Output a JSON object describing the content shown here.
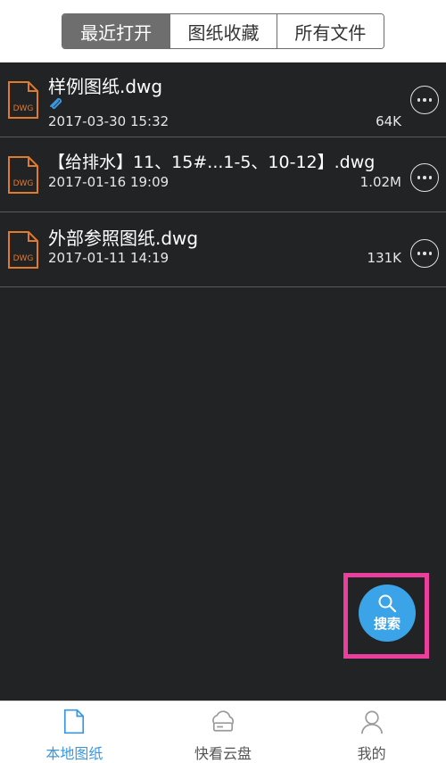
{
  "tabs": [
    {
      "label": "最近打开",
      "active": true
    },
    {
      "label": "图纸收藏",
      "active": false
    },
    {
      "label": "所有文件",
      "active": false
    }
  ],
  "files": [
    {
      "name": "样例图纸.dwg",
      "date": "2017-03-30 15:32",
      "size": "64K",
      "has_attachment": true,
      "icon_text": "DWG"
    },
    {
      "name": "【给排水】11、15#...1-5、10-12】.dwg",
      "date": "2017-01-16 19:09",
      "size": "1.02M",
      "has_attachment": false,
      "icon_text": "DWG"
    },
    {
      "name": "外部参照图纸.dwg",
      "date": "2017-01-11 14:19",
      "size": "131K",
      "has_attachment": false,
      "icon_text": "DWG"
    }
  ],
  "fab": {
    "label": "搜索",
    "icon": "search-icon",
    "color": "#3ba4e8",
    "highlight_color": "#ea3f9d"
  },
  "nav": [
    {
      "label": "本地图纸",
      "icon": "document-icon",
      "active": true
    },
    {
      "label": "快看云盘",
      "icon": "cloud-drive-icon",
      "active": false
    },
    {
      "label": "我的",
      "icon": "user-icon",
      "active": false
    }
  ],
  "colors": {
    "background": "#222325",
    "accent": "#3a97dd",
    "file_icon": "#e07a2c"
  }
}
